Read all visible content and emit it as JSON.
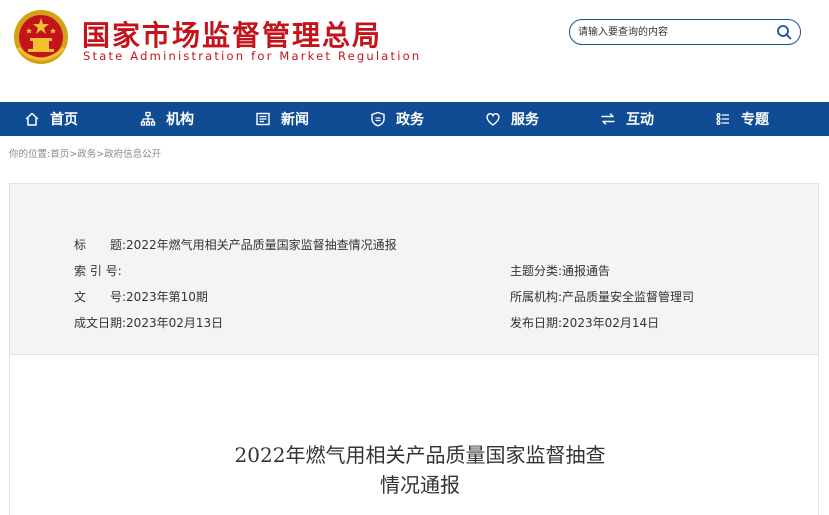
{
  "header": {
    "site_name_cn": "国家市场监督管理总局",
    "site_name_en": "State Administration for Market Regulation",
    "colors": {
      "brand_red": "#c4141b",
      "nav_blue": "#0f4c93"
    }
  },
  "search": {
    "placeholder": "请输入要查询的内容",
    "icon": "search-icon"
  },
  "nav": {
    "items": [
      {
        "label": "首页",
        "icon": "home-icon"
      },
      {
        "label": "机构",
        "icon": "org-chart-icon"
      },
      {
        "label": "新闻",
        "icon": "news-icon"
      },
      {
        "label": "政务",
        "icon": "shield-icon"
      },
      {
        "label": "服务",
        "icon": "heart-icon"
      },
      {
        "label": "互动",
        "icon": "exchange-icon"
      },
      {
        "label": "专题",
        "icon": "list-icon"
      }
    ]
  },
  "breadcrumb": {
    "prefix": "你的位置:",
    "items": [
      "首页",
      "政务",
      "政府信息公开"
    ],
    "separator": ">"
  },
  "meta": {
    "title_label": "标　　题:",
    "title_value": "2022年燃气用相关产品质量国家监督抽查情况通报",
    "index_label": "索 引 号:",
    "index_value": "",
    "doc_no_label": "文　　号:",
    "doc_no_value": "2023年第10期",
    "created_label": "成文日期:",
    "created_value": "2023年02月13日",
    "category_label": "主题分类:",
    "category_value": "通报通告",
    "org_label": "所属机构:",
    "org_value": "产品质量安全监督管理司",
    "published_label": "发布日期:",
    "published_value": "2023年02月14日"
  },
  "document": {
    "title_line1": "2022年燃气用相关产品质量国家监督抽查",
    "title_line2": "情况通报"
  }
}
